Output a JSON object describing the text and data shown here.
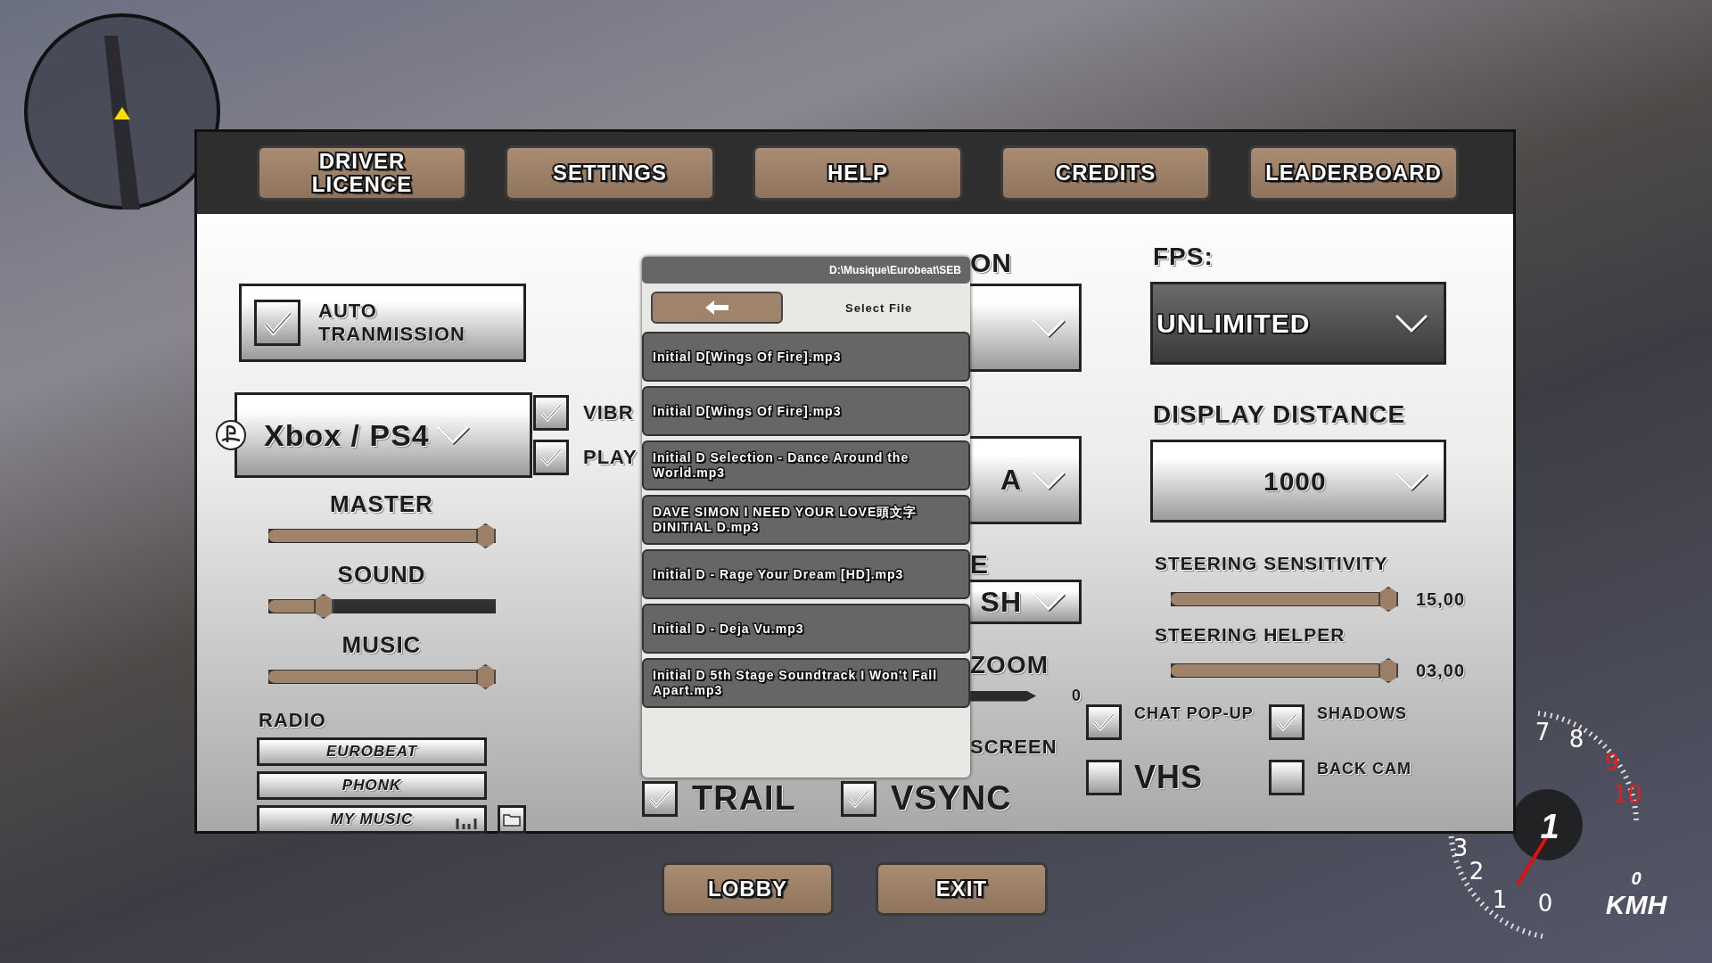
{
  "tabs": [
    "DRIVER LICENCE",
    "SETTINGS",
    "HELP",
    "CREDITS",
    "LEADERBOARD"
  ],
  "auto_transmission": {
    "label": "AUTO TRANMISSION",
    "checked": true
  },
  "controller": {
    "value": "Xbox / PS4"
  },
  "toggles_left": [
    {
      "label": "VIBR",
      "checked": true
    },
    {
      "label": "PLAY",
      "checked": true
    }
  ],
  "volume_sliders": [
    {
      "label": "MASTER",
      "level": 1
    },
    {
      "label": "SOUND",
      "level": 0.22
    },
    {
      "label": "MUSIC",
      "level": 1
    }
  ],
  "radio": {
    "label": "RADIO",
    "stations": [
      "EUROBEAT",
      "PHONK",
      "MY MUSIC"
    ]
  },
  "file_picker": {
    "path": "D:\\Musique\\Eurobeat\\SEB",
    "title": "Select File",
    "files": [
      "Initial D[Wings Of Fire].mp3",
      "Initial D[Wings Of Fire].mp3",
      "Initial D Selection - Dance Around the World.mp3",
      "DAVE SIMON I NEED YOUR LOVE頭文字DINITIAL D.mp3",
      "Initial D - Rage Your Dream [HD].mp3",
      "Initial D - Deja Vu.mp3",
      "Initial D 5th Stage Soundtrack I Won't Fall Apart.mp3"
    ]
  },
  "covered_settings": {
    "resolution_label": "ON",
    "quality_value": "A",
    "mode_label": "E",
    "mode_value": "SH",
    "zoom_label": "ZOOM",
    "zoom_value": "0",
    "fullscreen_label": "SCREEN"
  },
  "bottom_toggles": [
    {
      "label": "TRAIL",
      "checked": true
    },
    {
      "label": "VSYNC",
      "checked": true
    }
  ],
  "fps": {
    "label": "FPS:",
    "value": "UNLIMITED"
  },
  "display_distance": {
    "label": "DISPLAY DISTANCE",
    "value": "1000"
  },
  "steering_sliders": [
    {
      "label": "STEERING SENSITIVITY",
      "level": 1,
      "reading": "15,00"
    },
    {
      "label": "STEERING HELPER",
      "level": 1,
      "reading": "03,00"
    }
  ],
  "options": [
    {
      "label": "CHAT POP-UP",
      "checked": true
    },
    {
      "label": "SHADOWS",
      "checked": true
    },
    {
      "label": "VHS",
      "checked": false
    },
    {
      "label": "BACK CAM",
      "checked": false
    }
  ],
  "footer_buttons": [
    "LOBBY",
    "EXIT"
  ],
  "speedometer": {
    "gear": "1",
    "speed": "0",
    "unit": "KMH",
    "dial_labels": [
      "0",
      "1",
      "2",
      "3",
      "7",
      "8",
      "9",
      "10"
    ]
  }
}
